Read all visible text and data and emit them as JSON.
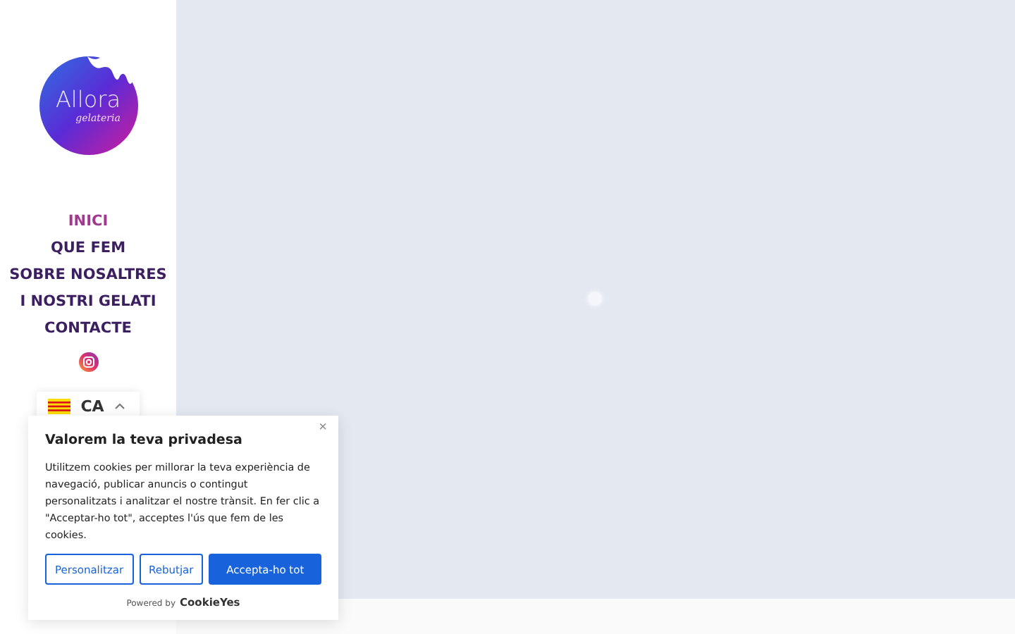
{
  "logo": {
    "name": "Allora",
    "tagline": "gelateria"
  },
  "nav": [
    {
      "label": "INICI",
      "selected": true
    },
    {
      "label": "QUE FEM",
      "selected": false
    },
    {
      "label": "SOBRE NOSALTRES",
      "selected": false
    },
    {
      "label": "I NOSTRI GELATI",
      "selected": false
    },
    {
      "label": "CONTACTE",
      "selected": false
    }
  ],
  "language": {
    "code": "CA",
    "expanded": true
  },
  "cookie_banner": {
    "title": "Valorem la teva privadesa",
    "close": "×",
    "text": "Utilitzem cookies per millorar la teva experiència de navegació, publicar anuncis o contingut personalitzats i analitzar el nostre trànsit. En fer clic a \"Acceptar-ho tot\", acceptes l'ús que fem de les cookies.",
    "buttons": [
      {
        "label": "Personalitzar",
        "kind": "outline"
      },
      {
        "label": "Rebutjar",
        "kind": "outline"
      },
      {
        "label": "Accepta-ho tot",
        "kind": "primary"
      }
    ],
    "powered_by": "Powered by",
    "brand": "CookieYes"
  }
}
